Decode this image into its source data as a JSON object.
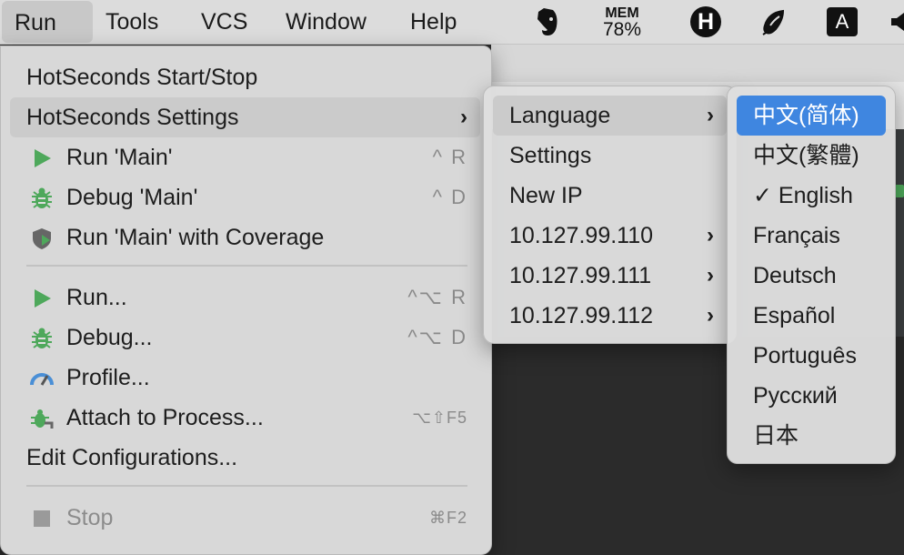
{
  "menubar": {
    "items": [
      "Run",
      "Tools",
      "VCS",
      "Window",
      "Help"
    ],
    "mem_label": "MEM",
    "mem_value": "78%",
    "h_badge": "H",
    "a_badge": "A"
  },
  "run_menu": {
    "hotseconds_startstop": "HotSeconds Start/Stop",
    "hotseconds_settings": "HotSeconds Settings",
    "run_main": "Run 'Main'",
    "run_main_shortcut": "^ R",
    "debug_main": "Debug 'Main'",
    "debug_main_shortcut": "^ D",
    "run_coverage": "Run 'Main' with Coverage",
    "run": "Run...",
    "run_shortcut": "^⌥ R",
    "debug": "Debug...",
    "debug_shortcut": "^⌥ D",
    "profile": "Profile...",
    "attach": "Attach to Process...",
    "attach_shortcut": "⌥⇧F5",
    "edit_config": "Edit Configurations...",
    "stop": "Stop",
    "stop_shortcut": "⌘F2"
  },
  "hotseconds_submenu": {
    "items": [
      "Language",
      "Settings",
      "New IP",
      "10.127.99.110",
      "10.127.99.111",
      "10.127.99.112"
    ]
  },
  "language_submenu": {
    "items": [
      "中文(简体)",
      "中文(繁體)",
      "✓ English",
      "Français",
      "Deutsch",
      "Español",
      "Português",
      "Русский",
      "日本"
    ],
    "selected": "中文(简体)",
    "checked": "English"
  },
  "colors": {
    "selection": "#3f86e0",
    "run_green": "#4ea85b"
  }
}
